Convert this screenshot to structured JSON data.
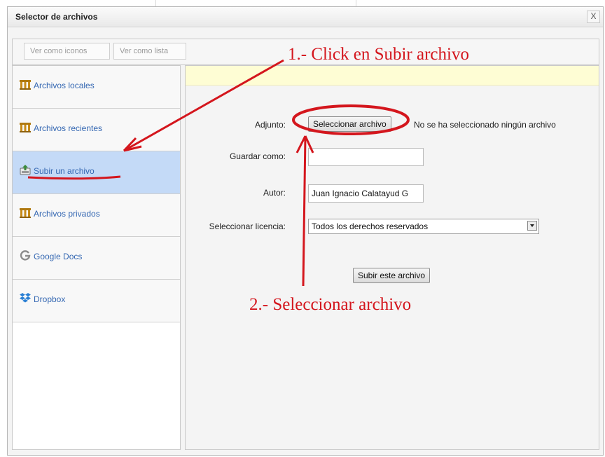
{
  "dialog": {
    "title": "Selector de archivos",
    "close_glyph": "X"
  },
  "toolbar": {
    "view_icons_label": "Ver como iconos",
    "view_list_label": "Ver como lista"
  },
  "sidebar": {
    "items": [
      {
        "label": "Archivos locales",
        "icon": "repository-icon",
        "selected": false
      },
      {
        "label": "Archivos recientes",
        "icon": "repository-icon",
        "selected": false
      },
      {
        "label": "Subir un archivo",
        "icon": "upload-icon",
        "selected": true
      },
      {
        "label": "Archivos privados",
        "icon": "repository-icon",
        "selected": false
      },
      {
        "label": "Google Docs",
        "icon": "google-icon",
        "selected": false
      },
      {
        "label": "Dropbox",
        "icon": "dropbox-icon",
        "selected": false
      }
    ]
  },
  "form": {
    "attachment_label": "Adjunto:",
    "choose_file_label": "Seleccionar archivo",
    "no_file_text": "No se ha seleccionado ningún archivo",
    "save_as_label": "Guardar como:",
    "save_as_value": "",
    "author_label": "Autor:",
    "author_value": "Juan Ignacio Calatayud G",
    "license_label": "Seleccionar licencia:",
    "license_value": "Todos los derechos reservados",
    "submit_label": "Subir este archivo"
  },
  "annotations": {
    "step1": "1.- Click en Subir archivo",
    "step2": "2.- Seleccionar archivo",
    "color": "#d4161d"
  },
  "colors": {
    "selected_item_bg": "#c4daf7",
    "link_text": "#3467b2",
    "notice_bg": "#fefdd4"
  }
}
